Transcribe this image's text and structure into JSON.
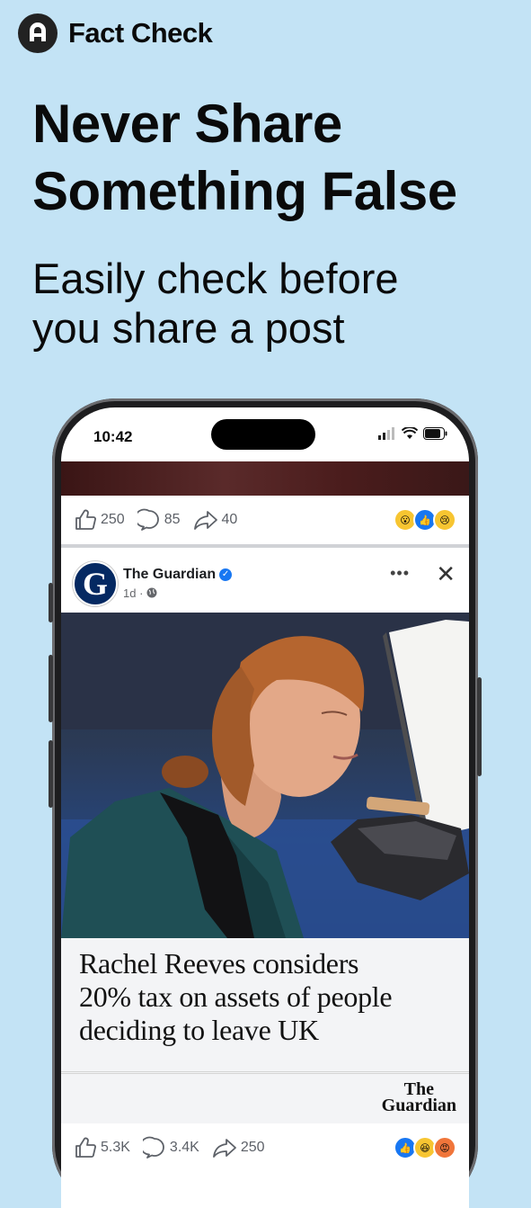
{
  "brand": {
    "name": "Fact Check"
  },
  "headline": {
    "line1": "Never Share",
    "line2": "Something False"
  },
  "subhead": {
    "line1": "Easily check before",
    "line2": "you share a post"
  },
  "phone": {
    "status_time": "10:42",
    "previous_post": {
      "likes": "250",
      "comments": "85",
      "shares": "40"
    },
    "post": {
      "page_name": "The Guardian",
      "meta": "1d ·",
      "avatar_letter": "G",
      "article_title_lines": [
        "Rachel Reeves considers",
        "20% tax on assets of people",
        "deciding to leave UK"
      ],
      "source_logo_line1": "The",
      "source_logo_line2": "Guardian",
      "likes": "5.3K",
      "comments": "3.4K",
      "shares": "250"
    }
  },
  "colors": {
    "background": "#c3e3f5",
    "facebook_blue": "#1877f2",
    "guardian_navy": "#052962"
  }
}
